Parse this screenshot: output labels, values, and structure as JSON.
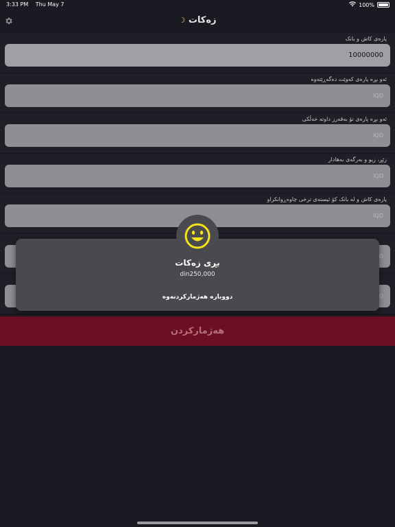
{
  "status_bar": {
    "time": "3:33 PM",
    "date": "Thu May 7",
    "battery": "100%"
  },
  "nav": {
    "title": "زەکات",
    "settings_icon": "gear-icon",
    "title_icon": "moon-icon"
  },
  "fields": [
    {
      "label": "پارەی کاش و بانک",
      "value": "10000000",
      "placeholder": "IQD"
    },
    {
      "label": "ئەو بڕە پارەی کەوێت دەگەڕێتەوە",
      "value": "",
      "placeholder": "IQD"
    },
    {
      "label": "ئەو بڕە پارەی تۆ بەقەرز داوتە خەڵکی",
      "value": "",
      "placeholder": "IQD"
    },
    {
      "label": "زێڕ، زیو و بەرگەی بەهادار",
      "value": "",
      "placeholder": "IQD"
    },
    {
      "label": "پارەی کاش و لە بانک کۆ ئیستەی ترخی چاوەڕوانکراو",
      "value": "",
      "placeholder": "IQD"
    },
    {
      "label": "",
      "value": "",
      "placeholder": "IQD"
    },
    {
      "label": "",
      "value": "",
      "placeholder": "IQD"
    }
  ],
  "calculate_button": "هەژمارکردن",
  "popup": {
    "icon": "smiley-icon",
    "title": "بڕی زەکات",
    "amount": "din250,000",
    "action": "دووبارە هەژمارکردنەوە"
  },
  "colors": {
    "background": "#1a1a22",
    "button": "#6d0f23",
    "popup": "#4a4a4e",
    "smiley": "#f5e31a"
  }
}
